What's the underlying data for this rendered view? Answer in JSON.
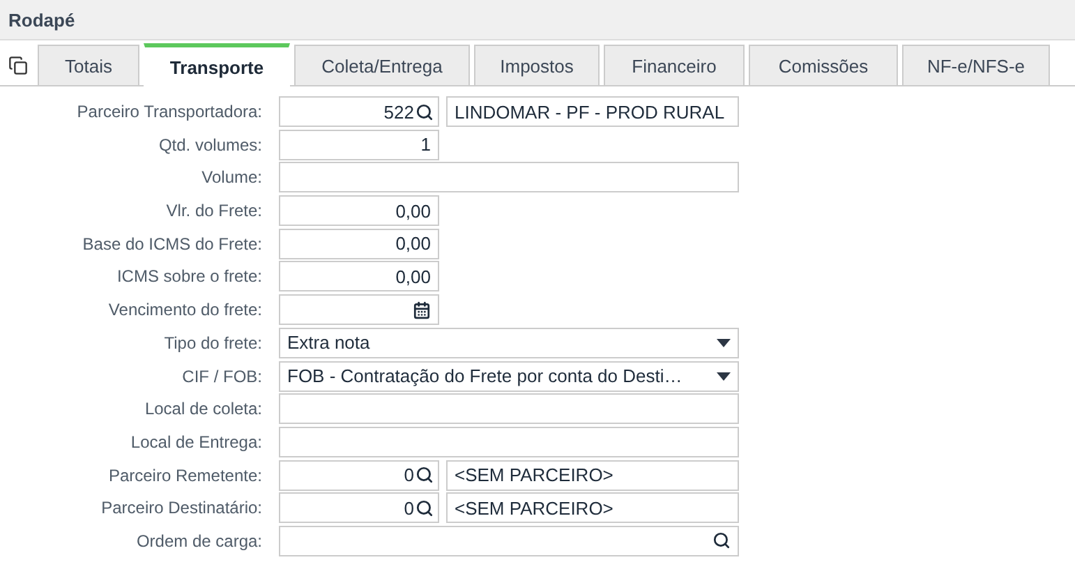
{
  "section": {
    "title": "Rodapé"
  },
  "tabs": [
    {
      "label": "Totais",
      "selected": false
    },
    {
      "label": "Transporte",
      "selected": true
    },
    {
      "label": "Coleta/Entrega",
      "selected": false
    },
    {
      "label": "Impostos",
      "selected": false
    },
    {
      "label": "Financeiro",
      "selected": false
    },
    {
      "label": "Comissões",
      "selected": false
    },
    {
      "label": "NF-e/NFS-e",
      "selected": false
    }
  ],
  "fields": [
    {
      "label": "Parceiro Transportadora:",
      "kind": "lookup",
      "value": "522",
      "name": "LINDOMAR - PF - PROD RURAL"
    },
    {
      "label": "Qtd. volumes:",
      "kind": "number",
      "value": "1"
    },
    {
      "label": "Volume:",
      "kind": "text"
    },
    {
      "label": "Vlr. do Frete:",
      "kind": "number",
      "value": "0,00"
    },
    {
      "label": "Base do ICMS do Frete:",
      "kind": "number",
      "value": "0,00"
    },
    {
      "label": "ICMS sobre o frete:",
      "kind": "number",
      "value": "0,00"
    },
    {
      "label": "Vencimento do frete:",
      "kind": "date"
    },
    {
      "label": "Tipo do frete:",
      "kind": "select",
      "value": "Extra nota"
    },
    {
      "label": "CIF / FOB:",
      "kind": "select",
      "value": "FOB - Contratação do Frete por conta do Desti…"
    },
    {
      "label": "Local de coleta:",
      "kind": "text"
    },
    {
      "label": "Local de Entrega:",
      "kind": "text"
    },
    {
      "label": "Parceiro Remetente:",
      "kind": "lookup",
      "value": "0",
      "name": "<SEM PARCEIRO>"
    },
    {
      "label": "Parceiro Destinatário:",
      "kind": "lookup",
      "value": "0",
      "name": "<SEM PARCEIRO>"
    },
    {
      "label": "Ordem de carga:",
      "kind": "search"
    }
  ]
}
